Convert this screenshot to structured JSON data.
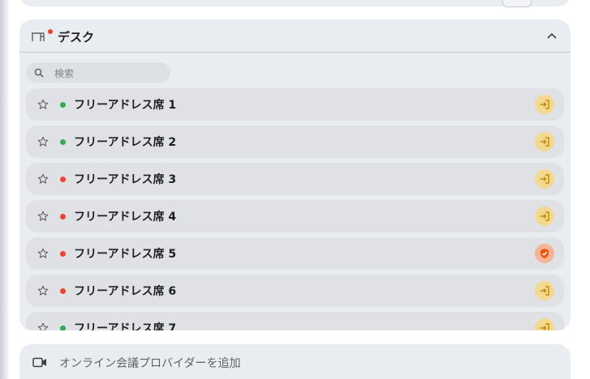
{
  "panel": {
    "title": "デスク"
  },
  "search": {
    "placeholder": "検索"
  },
  "rooms": [
    {
      "name": "フリーアドレス席 1",
      "status": "available",
      "action": "enter"
    },
    {
      "name": "フリーアドレス席 2",
      "status": "available",
      "action": "enter"
    },
    {
      "name": "フリーアドレス席 3",
      "status": "busy",
      "action": "enter"
    },
    {
      "name": "フリーアドレス席 4",
      "status": "busy",
      "action": "enter"
    },
    {
      "name": "フリーアドレス席 5",
      "status": "busy",
      "action": "shield"
    },
    {
      "name": "フリーアドレス席 6",
      "status": "busy",
      "action": "enter"
    },
    {
      "name": "フリーアドレス席 7",
      "status": "available",
      "action": "enter"
    }
  ],
  "colors": {
    "available": "#34a853",
    "busy": "#ea4335",
    "enter_bg": "#f3d98f",
    "enter_fg": "#c58a0a",
    "shield_bg": "#f6b49a",
    "shield_fg": "#e8590c"
  },
  "icons": {
    "desk": "desk-icon",
    "chevron": "chevron-up-icon",
    "search": "search-icon",
    "star": "star-outline-icon",
    "enter": "enter-room-icon",
    "shield": "shield-check-icon",
    "video": "video-camera-icon"
  },
  "bottom": {
    "label": "オンライン会議プロバイダーを追加"
  }
}
